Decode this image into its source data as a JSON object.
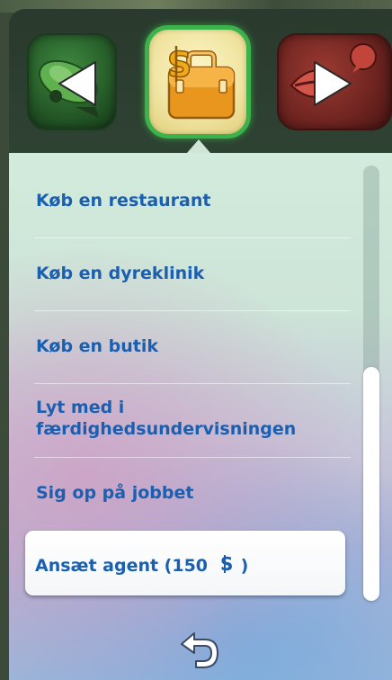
{
  "category_bar": {
    "left": {
      "icon": "car-arrow-icon",
      "arrow": "left-arrow-icon"
    },
    "center": {
      "icon": "briefcase-simoleon-icon",
      "selected": true
    },
    "right": {
      "icon": "mouth-speech-icon",
      "arrow": "right-arrow-icon"
    }
  },
  "menu": {
    "items": [
      {
        "label": "Køb en restaurant"
      },
      {
        "label": "Køb en dyreklinik"
      },
      {
        "label": "Køb en butik"
      },
      {
        "label": "Lyt med i"
      },
      {
        "label": "færdighedsundervisningen"
      },
      {
        "label": "Sig op på jobbet"
      }
    ],
    "selected": {
      "label": "Ansæt agent (150",
      "currency_icon": "simoleon-icon",
      "suffix": ")"
    }
  },
  "back": {
    "icon": "back-arrow-icon"
  },
  "colors": {
    "text": "#1a5fb0",
    "highlight_border": "#3bb24a"
  }
}
